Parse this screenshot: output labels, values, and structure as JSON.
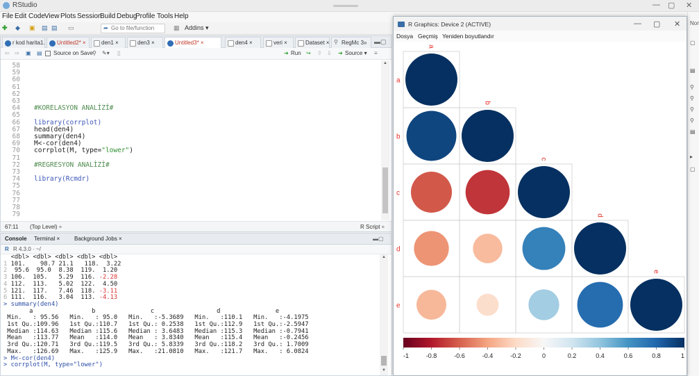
{
  "app": {
    "title": "RStudio",
    "controls": {
      "minimize": "—",
      "maximize": "▢",
      "close": "✕"
    }
  },
  "menubar": [
    "File",
    "Edit",
    "Code",
    "View",
    "Plots",
    "Session",
    "Build",
    "Debug",
    "Profile",
    "Tools",
    "Help"
  ],
  "toolbar": {
    "goto_placeholder": "Go to file/function",
    "addins_label": "Addins ▾"
  },
  "editor": {
    "tabs": [
      {
        "label": "r kod harita1.R ×",
        "icon": "r-file-icon"
      },
      {
        "label": "Untitled2* ×",
        "icon": "r-file-icon"
      },
      {
        "label": "den1 ×",
        "icon": "table-icon"
      },
      {
        "label": "den3 ×",
        "icon": "table-icon"
      },
      {
        "label": "Untitled3* ×",
        "icon": "r-file-icon"
      },
      {
        "label": "den4 ×",
        "icon": "table-icon"
      },
      {
        "label": "veri ×",
        "icon": "table-icon"
      },
      {
        "label": "Dataset ×",
        "icon": "table-icon"
      },
      {
        "label": "RegMc 3»",
        "icon": "search-icon"
      }
    ],
    "toolbar": {
      "source_on_save": "Source on Save",
      "run": "Run",
      "source": "Source ▾"
    },
    "lines": [
      {
        "n": "58",
        "code": "",
        "cls": ""
      },
      {
        "n": "59",
        "code": "",
        "cls": ""
      },
      {
        "n": "60",
        "code": "",
        "cls": ""
      },
      {
        "n": "61",
        "code": "",
        "cls": ""
      },
      {
        "n": "62",
        "code": "",
        "cls": ""
      },
      {
        "n": "63",
        "code": "",
        "cls": ""
      },
      {
        "n": "64",
        "code": "#KORELASYON ANALİZİ#",
        "cls": "cm"
      },
      {
        "n": "65",
        "code": "",
        "cls": ""
      },
      {
        "n": "66",
        "code": "library(corrplot)",
        "cls": "kw"
      },
      {
        "n": "67",
        "code": "head(den4)",
        "cls": ""
      },
      {
        "n": "68",
        "code": "summary(den4)",
        "cls": ""
      },
      {
        "n": "69",
        "code": "M<-cor(den4)",
        "cls": ""
      },
      {
        "n": "70",
        "code": "corrplot(M, type=\"lower\")",
        "cls": ""
      },
      {
        "n": "71",
        "code": "",
        "cls": ""
      },
      {
        "n": "72",
        "code": "#REGRESYON ANALİZİ#",
        "cls": "cm"
      },
      {
        "n": "73",
        "code": "",
        "cls": ""
      },
      {
        "n": "74",
        "code": "library(Rcmdr)",
        "cls": "kw"
      },
      {
        "n": "75",
        "code": "",
        "cls": ""
      },
      {
        "n": "76",
        "code": "",
        "cls": ""
      },
      {
        "n": "77",
        "code": "",
        "cls": ""
      },
      {
        "n": "78",
        "code": "",
        "cls": ""
      },
      {
        "n": "79",
        "code": "",
        "cls": ""
      }
    ],
    "status": {
      "position": "67:11",
      "scope": "(Top Level) ÷",
      "filetype": "R Script ÷"
    }
  },
  "console": {
    "tabs": [
      "Console",
      "Terminal ×",
      "Background Jobs ×"
    ],
    "path": "R 4.3.0 · ~/",
    "lines": [
      "  <dbl> <dbl> <dbl> <dbl> <dbl>",
      "1 101.    98.7 21.1   118.  3.22",
      "2  95.6  95.0  8.38  119.  1.20",
      "3 106.  105.   5.29  116. -2.28",
      "4 112.  113.   5.02  122.  4.50",
      "5 121.  117.   7.46  118. -3.11",
      "6 111.  116.   3.04  113. -4.13",
      "> summary(den4)",
      "       a                b               c                 d               e          ",
      " Min.   : 95.56   Min.   : 95.0   Min.   :-5.3689   Min.   :110.1   Min.   :-4.1975  ",
      " 1st Qu.:109.96   1st Qu.:110.7   1st Qu.: 0.2538   1st Qu.:112.9   1st Qu.:-2.5947  ",
      " Median :114.63   Median :115.6   Median : 3.6483   Median :115.3   Median :-0.7941  ",
      " Mean   :113.77   Mean   :114.0   Mean   : 3.8340   Mean   :115.4   Mean   :-0.2456  ",
      " 3rd Qu.:120.71   3rd Qu.:119.5   3rd Qu.: 5.8339   3rd Qu.:118.2   3rd Qu.: 1.7009  ",
      " Max.   :126.69   Max.   :125.9   Max.   :21.0810   Max.   :121.7   Max.   : 6.0824  ",
      "> M<-cor(den4)",
      "> corrplot(M, type=\"lower\")"
    ]
  },
  "graphics": {
    "title": "R Graphics: Device 2 (ACTIVE)",
    "menu": [
      "Dosya",
      "Geçmiş",
      "Yeniden boyutlandır"
    ]
  },
  "chart_data": {
    "type": "heatmap",
    "variables": [
      "a",
      "b",
      "c",
      "d",
      "e"
    ],
    "matrix_lower": [
      [
        1.0
      ],
      [
        0.92,
        1.0
      ],
      [
        -0.62,
        -0.72,
        1.0
      ],
      [
        -0.45,
        -0.32,
        0.68,
        1.0
      ],
      [
        -0.33,
        -0.18,
        0.35,
        0.77,
        1.0
      ]
    ],
    "colorbar_ticks": [
      "-1",
      "-0.8",
      "-0.6",
      "-0.4",
      "-0.2",
      "0",
      "0.2",
      "0.4",
      "0.6",
      "0.8",
      "1"
    ],
    "colors": {
      "neg": "#67001f",
      "mid": "#f7f7f7",
      "pos": "#053061",
      "label": "#e8302a"
    }
  }
}
